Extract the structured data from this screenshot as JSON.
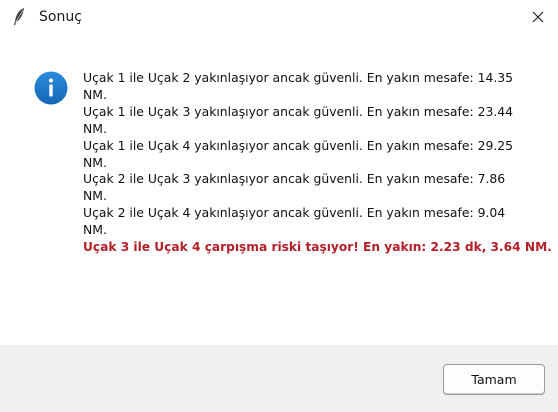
{
  "window": {
    "title": "Sonuç",
    "title_icon": "feather-icon",
    "close_icon": "close-icon"
  },
  "dialog": {
    "icon": "info-icon",
    "lines": [
      "Uçak 1 ile Uçak 2 yakınlaşıyor ancak güvenli. En yakın mesafe: 14.35",
      "NM.",
      "Uçak 1 ile Uçak 3 yakınlaşıyor ancak güvenli. En yakın mesafe: 23.44",
      "NM.",
      "Uçak 1 ile Uçak 4 yakınlaşıyor ancak güvenli. En yakın mesafe: 29.25",
      "NM.",
      "Uçak 2 ile Uçak 3 yakınlaşıyor ancak güvenli. En yakın mesafe: 7.86",
      "NM.",
      "Uçak 2 ile Uçak 4 yakınlaşıyor ancak güvenli. En yakın mesafe: 9.04",
      "NM."
    ],
    "alert_line": "Uçak 3 ile Uçak 4 çarpışma riski taşıyor! En yakın: 2.23 dk, 3.64 NM.",
    "alert_color": "#b3202a",
    "info_icon_color": "#1e73be"
  },
  "footer": {
    "ok_label": "Tamam"
  }
}
